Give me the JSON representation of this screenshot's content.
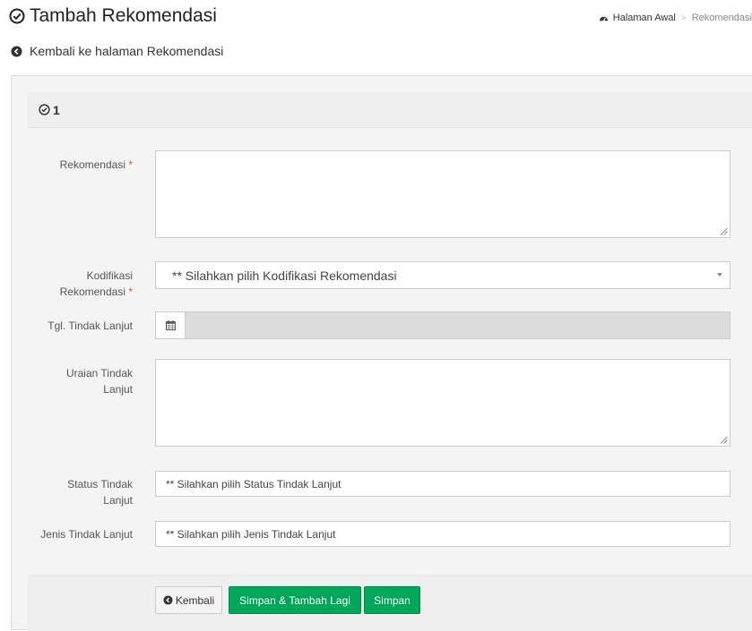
{
  "header": {
    "title": "Tambah Rekomendasi",
    "breadcrumb": {
      "home": "Halaman Awal",
      "current": "Rekomendasi"
    }
  },
  "back_link": "Kembali ke halaman Rekomendasi",
  "section": {
    "title": "1"
  },
  "form": {
    "rekomendasi": {
      "label": "Rekomendasi",
      "required_mark": "*",
      "value": ""
    },
    "kodifikasi": {
      "label_line1": "Kodifikasi",
      "label_line2": "Rekomendasi",
      "required_mark": "*",
      "selected": "** Silahkan pilih Kodifikasi Rekomendasi"
    },
    "tgl_tindak_lanjut": {
      "label": "Tgl. Tindak Lanjut",
      "value": ""
    },
    "uraian": {
      "label_line1": "Uraian Tindak",
      "label_line2": "Lanjut",
      "value": ""
    },
    "status": {
      "label_line1": "Status Tindak",
      "label_line2": "Lanjut",
      "selected": "** Silahkan pilih Status Tindak Lanjut"
    },
    "jenis": {
      "label": "Jenis Tindak Lanjut",
      "selected": "** Silahkan pilih Jenis Tindak Lanjut"
    }
  },
  "buttons": {
    "back": "Kembali",
    "save_add": "Simpan & Tambah Lagi",
    "save": "Simpan"
  },
  "colors": {
    "success": "#00a65a",
    "required": "#dd4b39"
  },
  "icons": [
    "check-circle-icon",
    "dashboard-icon",
    "chevron-circle-left-icon",
    "calendar-icon"
  ]
}
